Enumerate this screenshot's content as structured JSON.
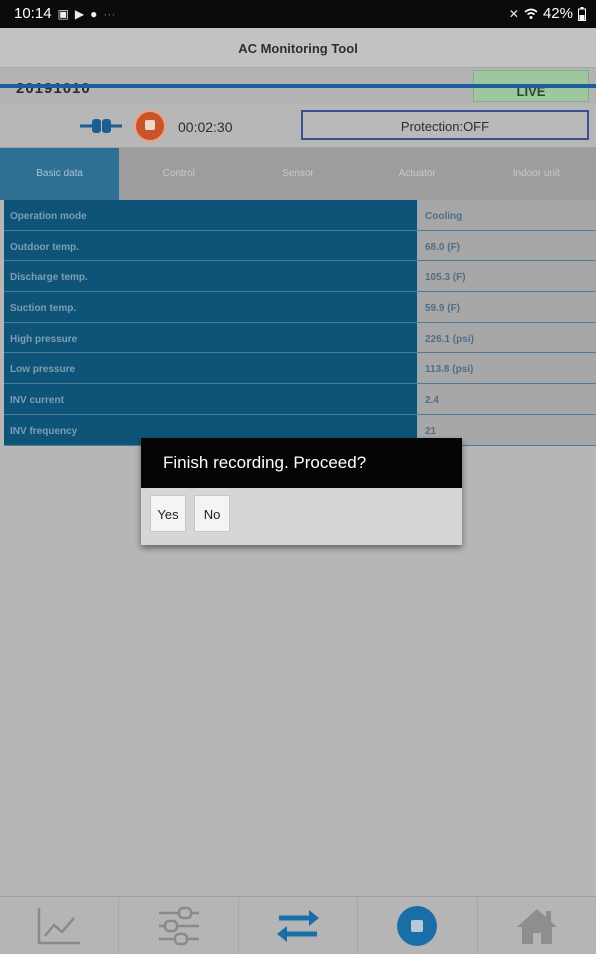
{
  "status_bar": {
    "time": "10:14",
    "battery": "42%",
    "notification_icons": [
      "gallery-icon",
      "play-icon",
      "sync-icon",
      "more-icon"
    ],
    "system_icons": [
      "mute-icon",
      "wifi-icon",
      "battery-icon"
    ]
  },
  "app": {
    "title": "AC Monitoring Tool"
  },
  "session": {
    "id": "20191010",
    "mode_label": "LIVE"
  },
  "control": {
    "elapsed": "00:02:30",
    "protection": "Protection:OFF"
  },
  "tabs": [
    {
      "label": "Basic data",
      "active": true
    },
    {
      "label": "Control",
      "active": false
    },
    {
      "label": "Sensor",
      "active": false
    },
    {
      "label": "Actuator",
      "active": false
    },
    {
      "label": "Indoor unit",
      "active": false
    }
  ],
  "rows": [
    {
      "label": "Operation mode",
      "value": "Cooling"
    },
    {
      "label": "Outdoor temp.",
      "value": "68.0 (F)"
    },
    {
      "label": "Discharge temp.",
      "value": "105.3 (F)"
    },
    {
      "label": "Suction temp.",
      "value": "59.9 (F)"
    },
    {
      "label": "High pressure",
      "value": "226.1 (psi)"
    },
    {
      "label": "Low pressure",
      "value": "113.8 (psi)"
    },
    {
      "label": "INV current",
      "value": "2.4"
    },
    {
      "label": "INV frequency",
      "value": "21"
    }
  ],
  "dialog": {
    "message": "Finish recording. Proceed?",
    "yes": "Yes",
    "no": "No"
  },
  "bottom_nav": [
    "graph-icon",
    "settings-sliders-icon",
    "transfer-icon",
    "stop-icon",
    "home-icon"
  ],
  "colors": {
    "accent": "#1e5e9e",
    "table_label_bg": "#0e5478",
    "stop_button": "#1a6ea7"
  }
}
